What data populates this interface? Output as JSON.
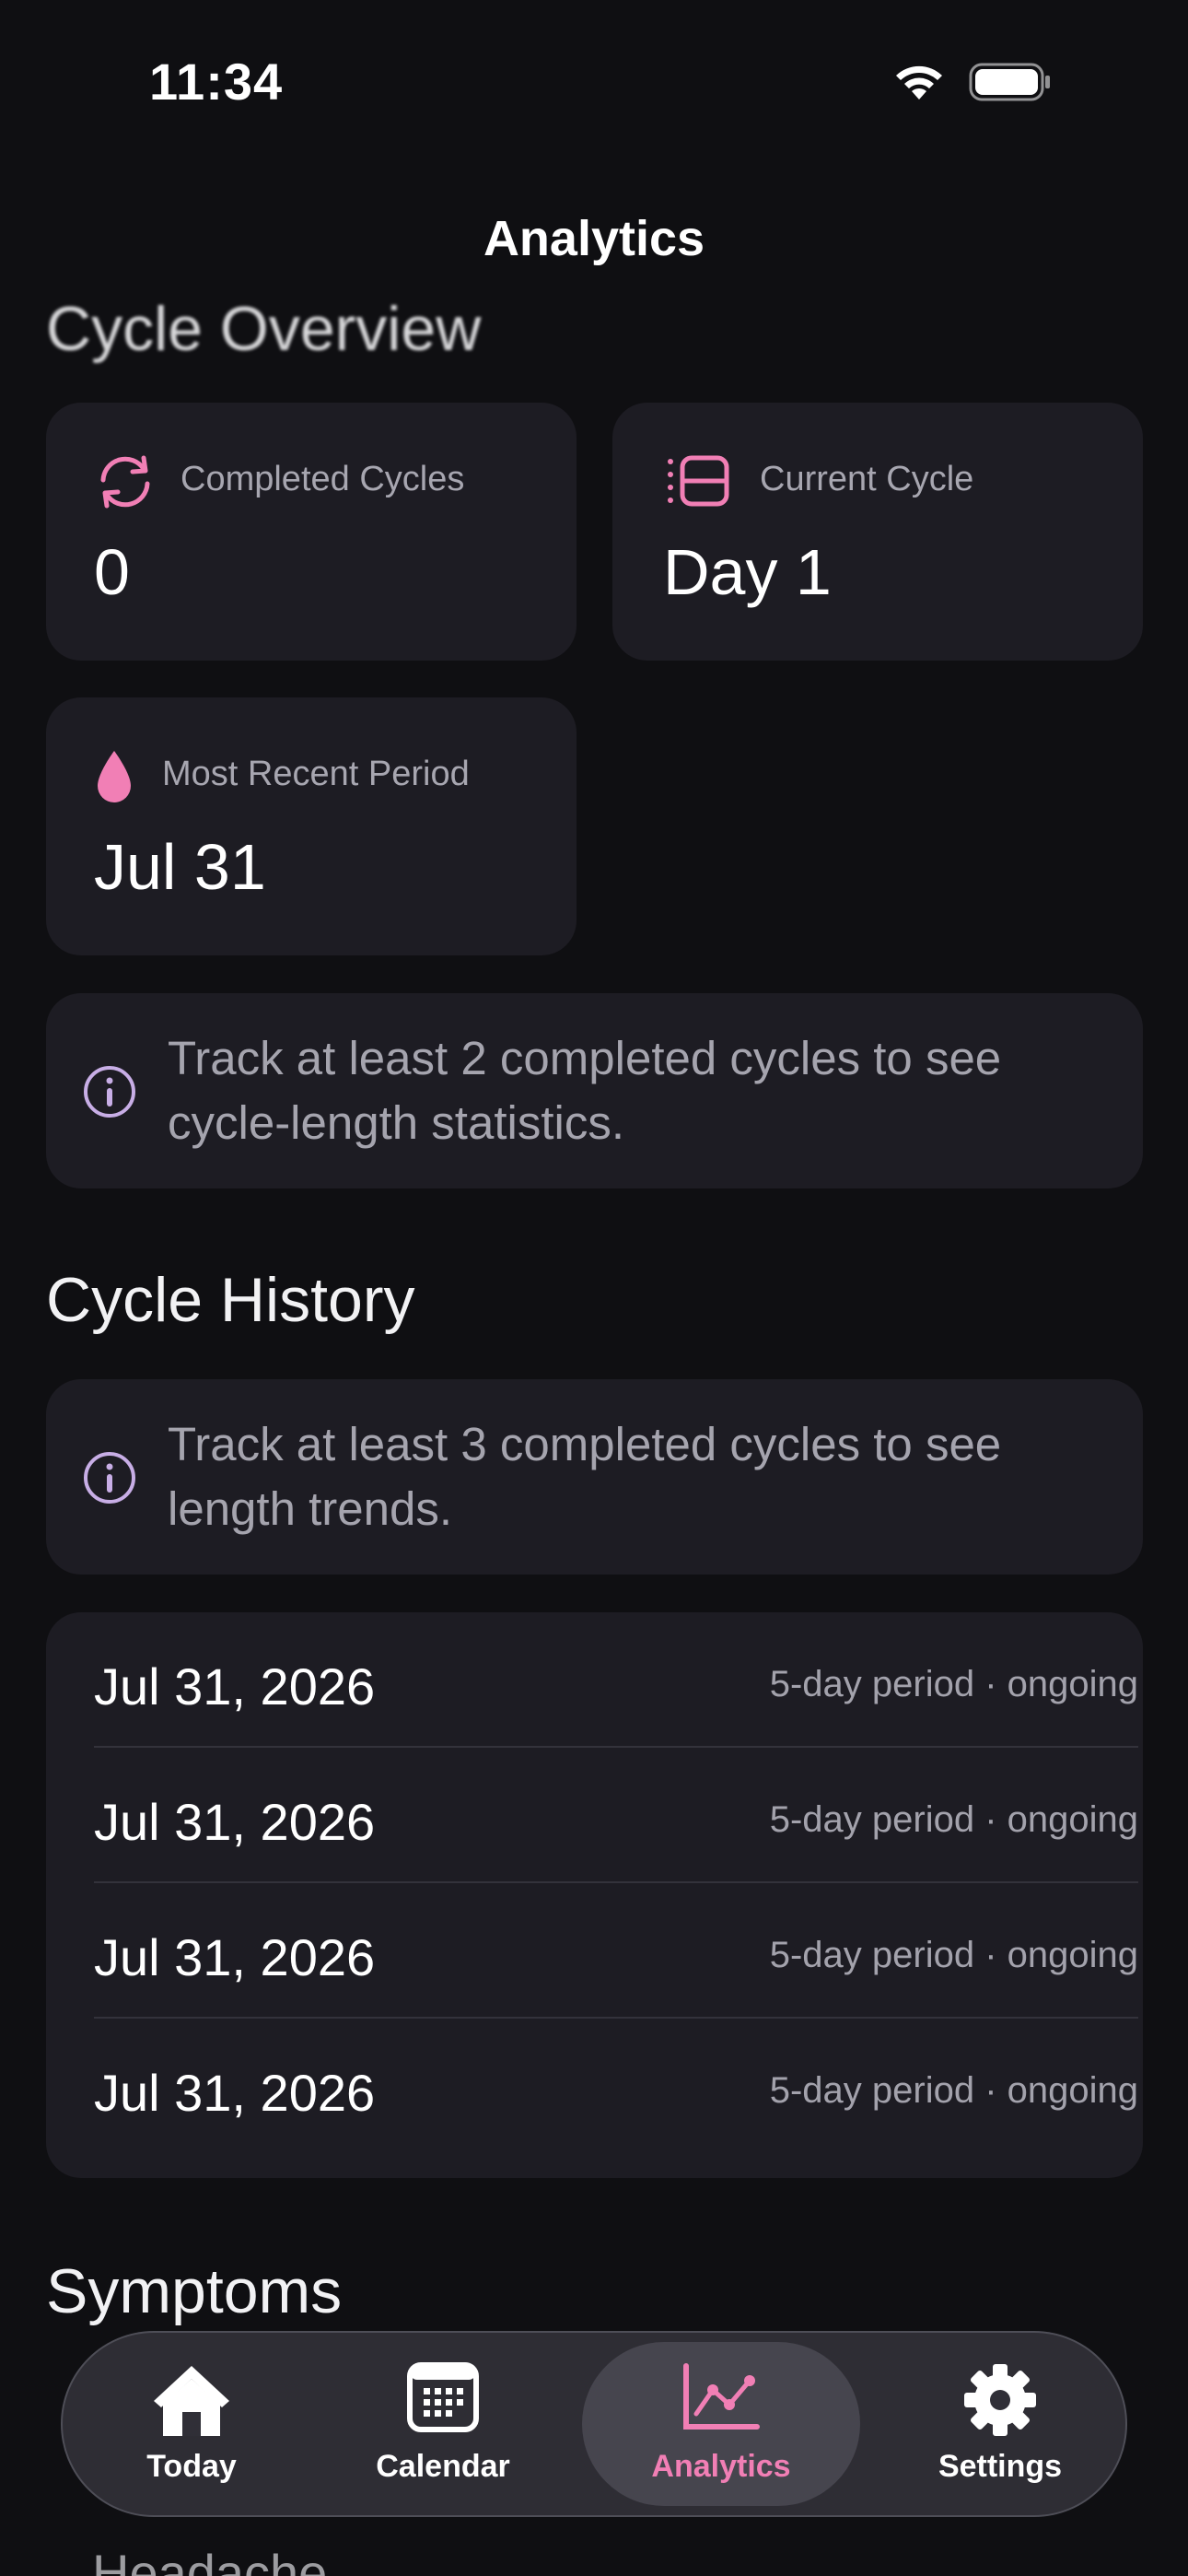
{
  "status_bar": {
    "time": "11:34"
  },
  "nav": {
    "title": "Analytics"
  },
  "overview": {
    "title": "Cycle Overview",
    "completed_cycles": {
      "label": "Completed Cycles",
      "value": "0",
      "icon": "cycle-arrows-icon"
    },
    "current_cycle": {
      "label": "Current Cycle",
      "value": "Day 1",
      "icon": "cycle-list-icon"
    },
    "most_recent_period": {
      "label": "Most Recent Period",
      "value": "Jul 31",
      "icon": "drop-icon"
    },
    "info": "Track at least 2 completed cycles to see cycle-length statistics."
  },
  "history": {
    "title": "Cycle History",
    "info": "Track at least 3 completed cycles to see length trends.",
    "rows": [
      {
        "date": "Jul 31, 2026",
        "detail": "5-day period · ongoing"
      },
      {
        "date": "Jul 31, 2026",
        "detail": "5-day period · ongoing"
      },
      {
        "date": "Jul 31, 2026",
        "detail": "5-day period · ongoing"
      },
      {
        "date": "Jul 31, 2026",
        "detail": "5-day period · ongoing"
      }
    ]
  },
  "symptoms": {
    "title": "Symptoms",
    "peek_item": "Headache"
  },
  "tab_bar": {
    "tabs": [
      {
        "label": "Today",
        "icon": "house-icon"
      },
      {
        "label": "Calendar",
        "icon": "calendar-icon"
      },
      {
        "label": "Analytics",
        "icon": "chart-icon",
        "active": true
      },
      {
        "label": "Settings",
        "icon": "gear-icon"
      }
    ]
  },
  "colors": {
    "accent": "#f17fb5",
    "info_icon": "#c8aee6",
    "card": "#1d1c23",
    "background": "#0f0f12"
  }
}
